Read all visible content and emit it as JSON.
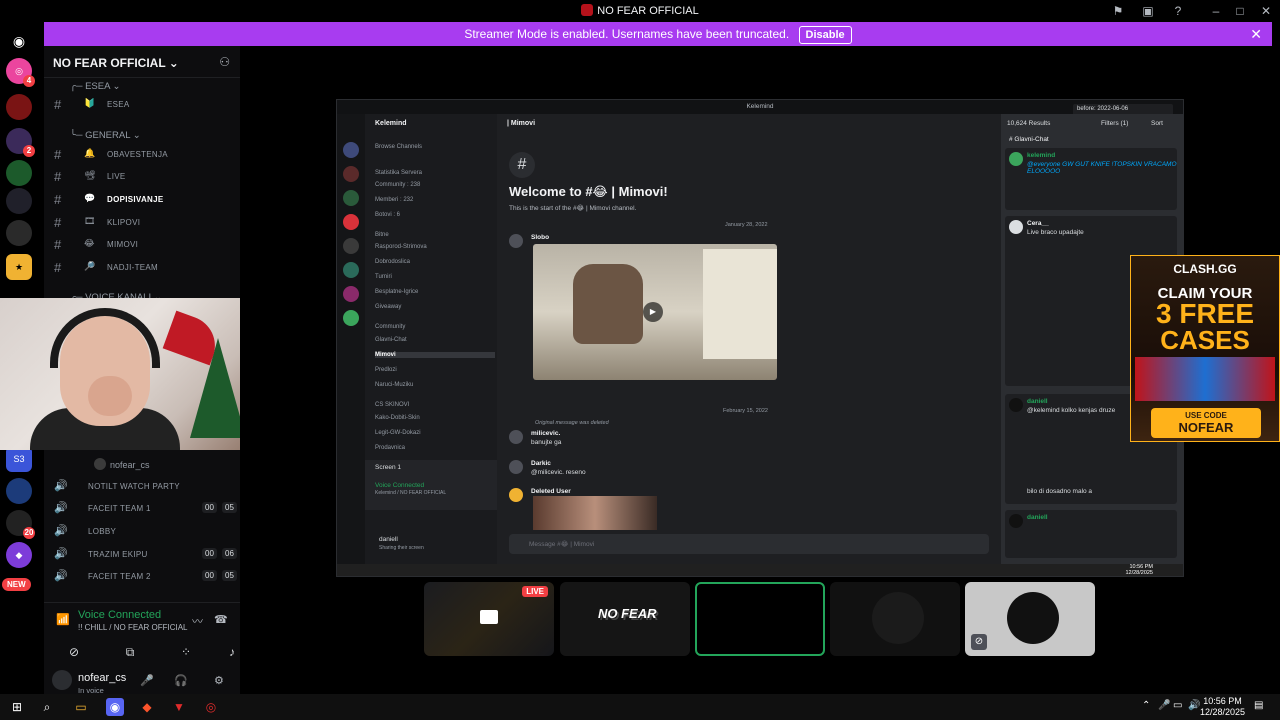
{
  "window": {
    "title": "NO FEAR OFFICIAL"
  },
  "banner": {
    "text": "Streamer Mode is enabled. Usernames have been truncated.",
    "disable_label": "Disable",
    "color": "#a83cf0"
  },
  "server": {
    "name": "NO FEAR OFFICIAL"
  },
  "rail": {
    "badges": [
      "4",
      "2",
      "20"
    ],
    "new_label": "NEW"
  },
  "categories": [
    {
      "name": "ESEA"
    },
    {
      "name": "GENERAL"
    },
    {
      "name": "VOICE KANALI"
    }
  ],
  "channels": [
    {
      "label": "ESEA",
      "emoji": "🔰"
    },
    {
      "label": "OBAVESTENJA",
      "emoji": "🔔"
    },
    {
      "label": "LIVE",
      "emoji": "📽"
    },
    {
      "label": "DOPISIVANJE",
      "emoji": "💬"
    },
    {
      "label": "KLIPOVI",
      "emoji": "🎞"
    },
    {
      "label": "MIMOVI",
      "emoji": "😂"
    },
    {
      "label": "NADJI-TEAM",
      "emoji": "🔎"
    }
  ],
  "voice_user": "nofear_cs",
  "voice_channels": [
    {
      "label": "NOTILT WATCH PARTY"
    },
    {
      "label": "FACEIT TEAM 1",
      "count_a": "00",
      "count_b": "05"
    },
    {
      "label": "LOBBY"
    },
    {
      "label": "TRAZIM EKIPU",
      "count_a": "00",
      "count_b": "06"
    },
    {
      "label": "FACEIT TEAM 2",
      "count_a": "00",
      "count_b": "05"
    }
  ],
  "voice_panel": {
    "status": "Voice Connected",
    "location": "!! CHILL / NO FEAR OFFICIAL"
  },
  "user": {
    "name": "nofear_cs",
    "status": "In voice"
  },
  "stream": {
    "window_title": "Kelemind",
    "server_name": "Kelemind",
    "browse": "Browse Channels",
    "sections": [
      "Statistika Servera",
      "Community : 238",
      "Memberi : 232",
      "Botovi : 6",
      "Bitne",
      "Rasporod-Strimova",
      "Dobrodoslica",
      "Turniri",
      "Besplatne-Igrice",
      "Giveaway",
      "Community",
      "Glavni-Chat",
      "Mimovi",
      "Predlozi",
      "Naruci-Muziku",
      "CS SKINOVI",
      "Kako-Dobiti-Skin",
      "Legit-GW-Dokazi",
      "Prodavnica"
    ],
    "screen_label": "Screen 1",
    "vc_label": "Voice Connected",
    "vc_sub": "Kelemind / NO FEAR OFFICIAL",
    "s_user": "daniell",
    "s_user_status": "Sharing their screen",
    "channel_header": "| Mimovi",
    "welcome": "Welcome to #😂 | Mimovi!",
    "welcome_sub": "This is the start of the #😂 | Mimovi channel.",
    "date1": "January 28, 2022",
    "date2": "February 15, 2022",
    "messages": [
      {
        "name": "Slobo",
        "text": "1/28/2022 10:07 PM"
      },
      {
        "name": "milicevic.",
        "text": "banujte ga"
      },
      {
        "name": "Darkic",
        "text": "@milicevic. reseno"
      },
      {
        "name": "Deleted User",
        "text": "2/15/2022 3:43 PM"
      }
    ],
    "orig_deleted": "Original message was deleted",
    "input_placeholder": "Message #😂 | Mimovi",
    "search_query": "before: 2022-06-06",
    "results_count": "10,624 Results",
    "filters": "Filters (1)",
    "sort": "Sort",
    "result_channel": "Glavni-Chat",
    "results": [
      {
        "name": "kelemind",
        "text": "@everyone GW GUT KNIFE !TOPSKIN VRACAMO ELOOOOO"
      },
      {
        "name": "Cera__",
        "text": "Live braco upadajte"
      },
      {
        "name": "daniell",
        "text": "@kelemind kolko kenjas druze"
      },
      {
        "name": "daniell",
        "text": "bilo di dosadno malo a"
      }
    ],
    "tray_time": "10:56 PM",
    "tray_date": "12/28/2025"
  },
  "ad": {
    "brand": "CLASH.GG",
    "line1": "CLAIM YOUR",
    "line2": "3 FREE",
    "line3": "CASES",
    "code_label": "USE CODE",
    "code": "NOFEAR",
    "accent": "#ffb21a"
  },
  "tiles": {
    "live_label": "LIVE",
    "nofear": "NO FEAR"
  },
  "taskbar": {
    "time": "10:56 PM",
    "date": "12/28/2025"
  }
}
